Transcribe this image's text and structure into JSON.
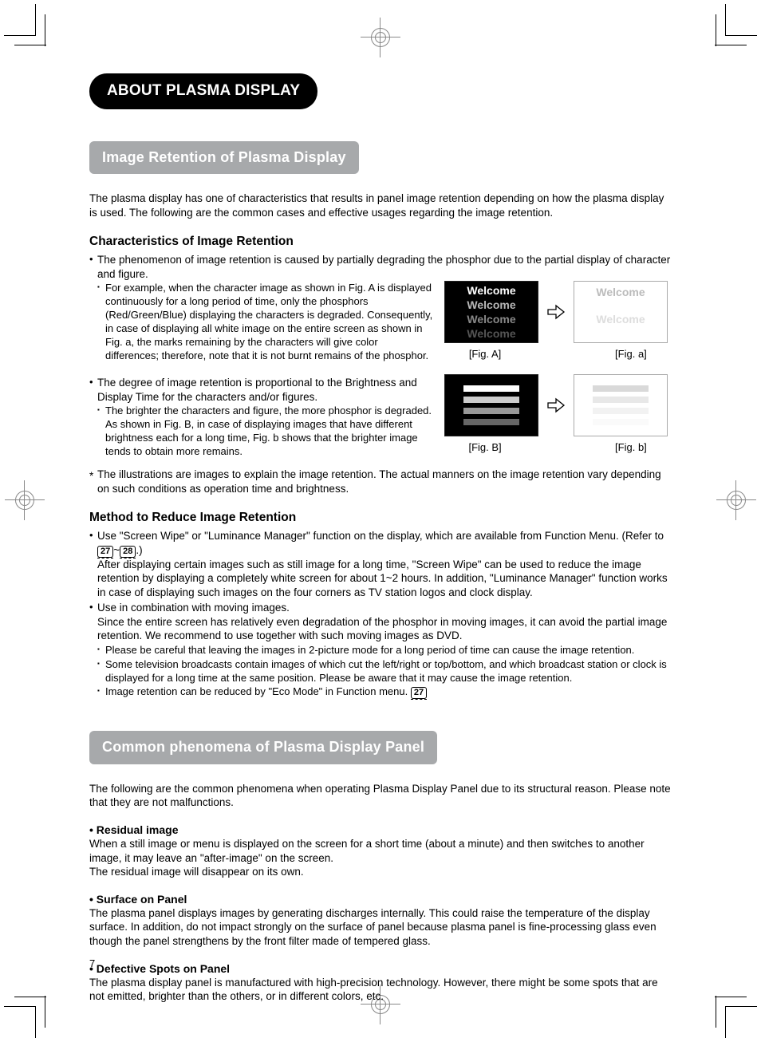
{
  "page_number": "7",
  "title_pill": "ABOUT PLASMA DISPLAY",
  "section1": {
    "heading": "Image Retention of Plasma Display",
    "intro": "The plasma display has one of characteristics that results in panel image retention depending on how the plasma display is used. The following are the common cases and effective usages regarding the image retention.",
    "char_heading": "Characteristics of Image Retention",
    "b1": "The phenomenon of image retention is caused by partially degrading the phosphor due to the partial display of character and figure.",
    "b1_sub": "For example, when the character image as shown in Fig. A is displayed continuously for a long period of time, only the phosphors (Red/Green/Blue) displaying the characters is degraded. Consequently, in case of displaying all white image on the entire screen as shown in Fig. a, the marks remaining by the characters will give color differences; therefore, note that it is not burnt remains of the phosphor.",
    "b2": "The degree of image retention is proportional to the Brightness and Display Time for the characters and/or figures.",
    "b2_sub": "The brighter the characters and figure, the more phosphor is degraded. As shown in Fig. B, in case of displaying images that have different brightness each for a long time, Fig. b shows that the brighter image tends to obtain more remains.",
    "note": "The illustrations are images to explain the image retention. The actual manners on the image retention vary depending on such conditions as operation time and brightness.",
    "method_heading": "Method to Reduce Image Retention",
    "m1_pre": "Use \"Screen Wipe\" or \"Luminance Manager\" function on the display, which are available from Function Menu. (Refer to ",
    "m1_ref1": "27",
    "m1_tilde": "~",
    "m1_ref2": "28",
    "m1_post": ".)",
    "m1_body": "After displaying certain images such as still image for a long time, \"Screen Wipe\" can be used to reduce the image retention by displaying a completely white screen for about 1~2 hours. In addition, \"Luminance Manager\" function works in case of displaying such images on the four corners as TV station logos and clock display.",
    "m2": "Use in combination with moving images.",
    "m2_body": "Since the entire screen has relatively even degradation of the phosphor in moving images, it can avoid the partial image retention. We recommend to use together with such moving images as DVD.",
    "m2_s1": "Please be careful that leaving the images in 2-picture mode for a long period of time can cause the image retention.",
    "m2_s2": "Some television broadcasts contain images of which cut the left/right or top/bottom, and which broadcast station or clock is displayed for a long time at the same position. Please be aware that it may cause the image retention.",
    "m2_s3_pre": "Image retention can be reduced by \"Eco Mode\" in Function menu. ",
    "m2_s3_ref": "27"
  },
  "figs": {
    "welcome": "Welcome",
    "figA": "[Fig. A]",
    "figa": "[Fig. a]",
    "figB": "[Fig. B]",
    "figb": "[Fig. b]"
  },
  "section2": {
    "heading": "Common phenomena of Plasma Display Panel",
    "intro": "The following are the common phenomena when operating Plasma Display Panel due to its structural reason. Please note that they are not malfunctions.",
    "h1": "Residual image",
    "p1": "When a still image or menu is displayed on the screen for a short time (about a minute) and then switches to another image, it may leave an \"after-image\" on the screen.\nThe residual image will disappear on its own.",
    "h2": "Surface on Panel",
    "p2": "The plasma panel displays images by generating discharges internally. This could raise the temperature of the display surface. In addition, do not impact strongly on the surface of panel because plasma panel is fine-processing glass even though the panel strengthens by the front filter made of tempered glass.",
    "h3": "Defective Spots on Panel",
    "p3": "The plasma display panel is manufactured with high-precision technology.  However, there might be some spots that are not emitted, brighter than the others, or in different colors, etc."
  }
}
